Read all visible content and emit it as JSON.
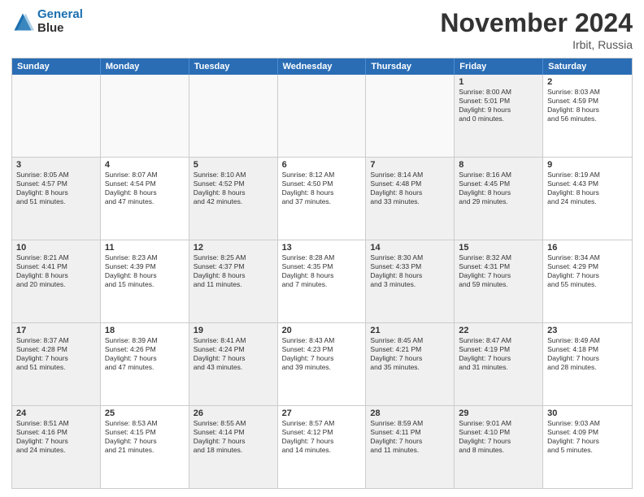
{
  "logo": {
    "line1": "General",
    "line2": "Blue"
  },
  "title": "November 2024",
  "location": "Irbit, Russia",
  "header_days": [
    "Sunday",
    "Monday",
    "Tuesday",
    "Wednesday",
    "Thursday",
    "Friday",
    "Saturday"
  ],
  "weeks": [
    [
      {
        "day": "",
        "text": "",
        "empty": true
      },
      {
        "day": "",
        "text": "",
        "empty": true
      },
      {
        "day": "",
        "text": "",
        "empty": true
      },
      {
        "day": "",
        "text": "",
        "empty": true
      },
      {
        "day": "",
        "text": "",
        "empty": true
      },
      {
        "day": "1",
        "text": "Sunrise: 8:00 AM\nSunset: 5:01 PM\nDaylight: 9 hours\nand 0 minutes.",
        "shaded": true
      },
      {
        "day": "2",
        "text": "Sunrise: 8:03 AM\nSunset: 4:59 PM\nDaylight: 8 hours\nand 56 minutes.",
        "shaded": false
      }
    ],
    [
      {
        "day": "3",
        "text": "Sunrise: 8:05 AM\nSunset: 4:57 PM\nDaylight: 8 hours\nand 51 minutes.",
        "shaded": true
      },
      {
        "day": "4",
        "text": "Sunrise: 8:07 AM\nSunset: 4:54 PM\nDaylight: 8 hours\nand 47 minutes.",
        "shaded": false
      },
      {
        "day": "5",
        "text": "Sunrise: 8:10 AM\nSunset: 4:52 PM\nDaylight: 8 hours\nand 42 minutes.",
        "shaded": true
      },
      {
        "day": "6",
        "text": "Sunrise: 8:12 AM\nSunset: 4:50 PM\nDaylight: 8 hours\nand 37 minutes.",
        "shaded": false
      },
      {
        "day": "7",
        "text": "Sunrise: 8:14 AM\nSunset: 4:48 PM\nDaylight: 8 hours\nand 33 minutes.",
        "shaded": true
      },
      {
        "day": "8",
        "text": "Sunrise: 8:16 AM\nSunset: 4:45 PM\nDaylight: 8 hours\nand 29 minutes.",
        "shaded": true
      },
      {
        "day": "9",
        "text": "Sunrise: 8:19 AM\nSunset: 4:43 PM\nDaylight: 8 hours\nand 24 minutes.",
        "shaded": false
      }
    ],
    [
      {
        "day": "10",
        "text": "Sunrise: 8:21 AM\nSunset: 4:41 PM\nDaylight: 8 hours\nand 20 minutes.",
        "shaded": true
      },
      {
        "day": "11",
        "text": "Sunrise: 8:23 AM\nSunset: 4:39 PM\nDaylight: 8 hours\nand 15 minutes.",
        "shaded": false
      },
      {
        "day": "12",
        "text": "Sunrise: 8:25 AM\nSunset: 4:37 PM\nDaylight: 8 hours\nand 11 minutes.",
        "shaded": true
      },
      {
        "day": "13",
        "text": "Sunrise: 8:28 AM\nSunset: 4:35 PM\nDaylight: 8 hours\nand 7 minutes.",
        "shaded": false
      },
      {
        "day": "14",
        "text": "Sunrise: 8:30 AM\nSunset: 4:33 PM\nDaylight: 8 hours\nand 3 minutes.",
        "shaded": true
      },
      {
        "day": "15",
        "text": "Sunrise: 8:32 AM\nSunset: 4:31 PM\nDaylight: 7 hours\nand 59 minutes.",
        "shaded": true
      },
      {
        "day": "16",
        "text": "Sunrise: 8:34 AM\nSunset: 4:29 PM\nDaylight: 7 hours\nand 55 minutes.",
        "shaded": false
      }
    ],
    [
      {
        "day": "17",
        "text": "Sunrise: 8:37 AM\nSunset: 4:28 PM\nDaylight: 7 hours\nand 51 minutes.",
        "shaded": true
      },
      {
        "day": "18",
        "text": "Sunrise: 8:39 AM\nSunset: 4:26 PM\nDaylight: 7 hours\nand 47 minutes.",
        "shaded": false
      },
      {
        "day": "19",
        "text": "Sunrise: 8:41 AM\nSunset: 4:24 PM\nDaylight: 7 hours\nand 43 minutes.",
        "shaded": true
      },
      {
        "day": "20",
        "text": "Sunrise: 8:43 AM\nSunset: 4:23 PM\nDaylight: 7 hours\nand 39 minutes.",
        "shaded": false
      },
      {
        "day": "21",
        "text": "Sunrise: 8:45 AM\nSunset: 4:21 PM\nDaylight: 7 hours\nand 35 minutes.",
        "shaded": true
      },
      {
        "day": "22",
        "text": "Sunrise: 8:47 AM\nSunset: 4:19 PM\nDaylight: 7 hours\nand 31 minutes.",
        "shaded": true
      },
      {
        "day": "23",
        "text": "Sunrise: 8:49 AM\nSunset: 4:18 PM\nDaylight: 7 hours\nand 28 minutes.",
        "shaded": false
      }
    ],
    [
      {
        "day": "24",
        "text": "Sunrise: 8:51 AM\nSunset: 4:16 PM\nDaylight: 7 hours\nand 24 minutes.",
        "shaded": true
      },
      {
        "day": "25",
        "text": "Sunrise: 8:53 AM\nSunset: 4:15 PM\nDaylight: 7 hours\nand 21 minutes.",
        "shaded": false
      },
      {
        "day": "26",
        "text": "Sunrise: 8:55 AM\nSunset: 4:14 PM\nDaylight: 7 hours\nand 18 minutes.",
        "shaded": true
      },
      {
        "day": "27",
        "text": "Sunrise: 8:57 AM\nSunset: 4:12 PM\nDaylight: 7 hours\nand 14 minutes.",
        "shaded": false
      },
      {
        "day": "28",
        "text": "Sunrise: 8:59 AM\nSunset: 4:11 PM\nDaylight: 7 hours\nand 11 minutes.",
        "shaded": true
      },
      {
        "day": "29",
        "text": "Sunrise: 9:01 AM\nSunset: 4:10 PM\nDaylight: 7 hours\nand 8 minutes.",
        "shaded": true
      },
      {
        "day": "30",
        "text": "Sunrise: 9:03 AM\nSunset: 4:09 PM\nDaylight: 7 hours\nand 5 minutes.",
        "shaded": false
      }
    ]
  ]
}
